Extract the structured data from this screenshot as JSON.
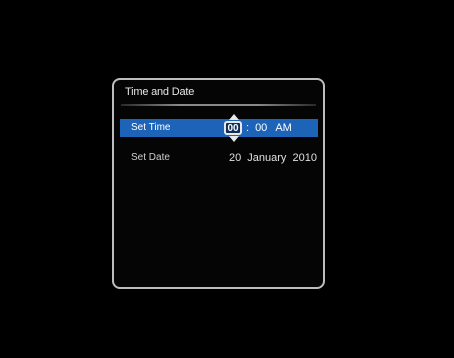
{
  "dialog": {
    "title": "Time and Date"
  },
  "set_time": {
    "label": "Set Time",
    "hour": "00",
    "separator": ":",
    "minute": "00",
    "ampm": "AM"
  },
  "set_date": {
    "label": "Set Date",
    "value": "20  January  2010"
  },
  "colors": {
    "highlight": "#1d64b8",
    "border": "#bdbdbd",
    "background": "#000000"
  }
}
